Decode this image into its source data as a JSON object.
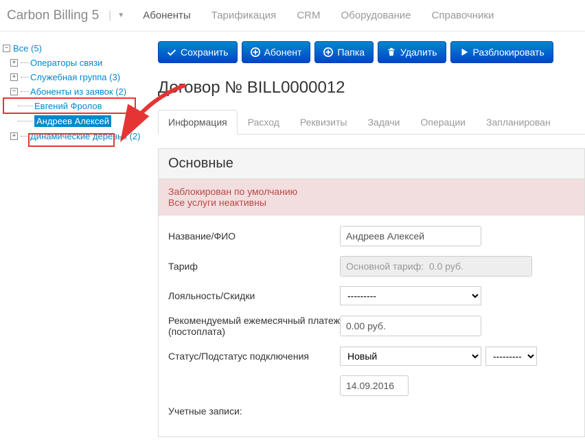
{
  "header": {
    "logo": "Carbon Billing 5",
    "nav": [
      "Абоненты",
      "Тарификация",
      "CRM",
      "Оборудование",
      "Справочники"
    ]
  },
  "sidebar": {
    "all": "Все (5)",
    "operators": "Операторы связи",
    "service_group": "Служебная группа (3)",
    "from_requests": "Абоненты из заявок (2)",
    "frolov": "Евгений Фролов",
    "andreev": "Андреев Алексей",
    "dynamic_trees": "Динамические деревья (2)"
  },
  "toolbar": {
    "save": "Сохранить",
    "subscriber": "Абонент",
    "folder": "Папка",
    "delete": "Удалить",
    "unblock": "Разблокировать"
  },
  "page_title": "Договор № BILL0000012",
  "tabs": [
    "Информация",
    "Расход",
    "Реквизиты",
    "Задачи",
    "Операции",
    "Запланирован"
  ],
  "panel": {
    "title": "Основные",
    "alert_line1": "Заблокирован по умолчанию",
    "alert_line2": "Все услуги неактивны",
    "labels": {
      "name": "Название/ФИО",
      "tariff": "Тариф",
      "loyalty": "Лояльность/Скидки",
      "recommended": "Рекомендуемый ежемесячный платеж (постоплата)",
      "status": "Статус/Подстатус подключения",
      "accounts": "Учетные записи:"
    },
    "values": {
      "name": "Андреев Алексей",
      "tariff": "Основной тариф:  0.0 руб.",
      "loyalty": "---------",
      "recommended": "0.00 руб.",
      "status": "Новый",
      "substatus": "---------",
      "date": "14.09.2016"
    }
  }
}
